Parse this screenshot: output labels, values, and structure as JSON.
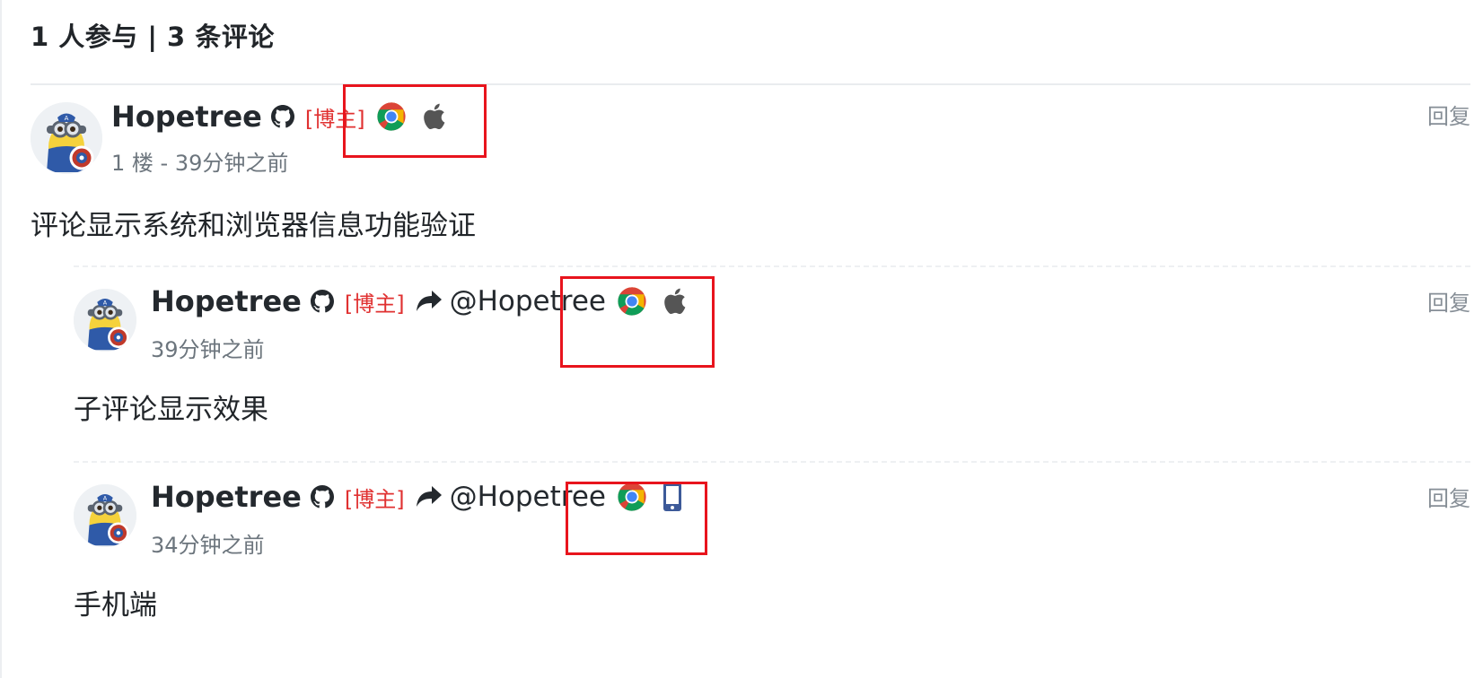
{
  "header": {
    "participants_count": "1 人参与 | 3 条评论"
  },
  "colors": {
    "highlight": "#e8141d",
    "role_badge": "#e03131",
    "meta_text": "#6c757d",
    "reply_text": "#868e96"
  },
  "comments": [
    {
      "author": "Hopetree",
      "role": "[博主]",
      "meta": "1 楼 - 39分钟之前",
      "content": "评论显示系统和浏览器信息功能验证",
      "reply_label": "回复",
      "browser_icon": "chrome-icon",
      "os_icon": "apple-icon"
    },
    {
      "author": "Hopetree",
      "role": "[博主]",
      "mention": "@Hopetree",
      "meta": "39分钟之前",
      "content": "子评论显示效果",
      "reply_label": "回复",
      "browser_icon": "chrome-icon",
      "os_icon": "apple-icon"
    },
    {
      "author": "Hopetree",
      "role": "[博主]",
      "mention": "@Hopetree",
      "meta": "34分钟之前",
      "content": "手机端",
      "reply_label": "回复",
      "browser_icon": "chrome-icon",
      "os_icon": "mobile-phone-icon"
    }
  ]
}
